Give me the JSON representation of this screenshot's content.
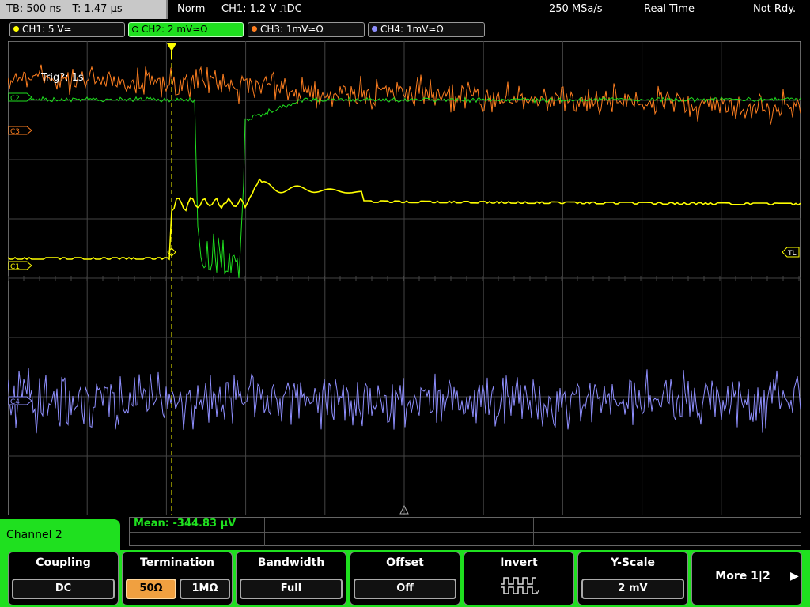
{
  "status": {
    "timebase": "TB: 500 ns",
    "trigger_time": "T: 1.47 µs",
    "mode": "Norm",
    "trigger_info": "CH1: 1.2 V ⎍DC",
    "sample_rate": "250 MSa/s",
    "acq_mode": "Real Time",
    "ready": "Not Rdy."
  },
  "channels": [
    {
      "label": "CH1: 5 V≃",
      "color": "#ffff00",
      "active": false
    },
    {
      "label": "CH2: 2 mV≃Ω",
      "color": "#1fe01f",
      "active": true
    },
    {
      "label": "CH3: 1mV≃Ω",
      "color": "#ff7f20",
      "active": false
    },
    {
      "label": "CH4: 1mV≃Ω",
      "color": "#8f8fff",
      "active": false
    }
  ],
  "markers": {
    "trig_text": "Trig?: 1s",
    "c2": "C2",
    "c3": "C3",
    "c1": "C1",
    "c4": "C4",
    "tl": "TL"
  },
  "measurement": {
    "mean": "Mean: -344.83 µV"
  },
  "menu": {
    "channel_title": "Channel 2",
    "coupling_title": "Coupling",
    "coupling_value": "DC",
    "termination_title": "Termination",
    "termination_50": "50Ω",
    "termination_1m": "1MΩ",
    "bandwidth_title": "Bandwidth",
    "bandwidth_value": "Full",
    "offset_title": "Offset",
    "offset_value": "Off",
    "invert_title": "Invert",
    "yscale_title": "Y-Scale",
    "yscale_value": "2 mV",
    "more_label": "More 1|2"
  }
}
